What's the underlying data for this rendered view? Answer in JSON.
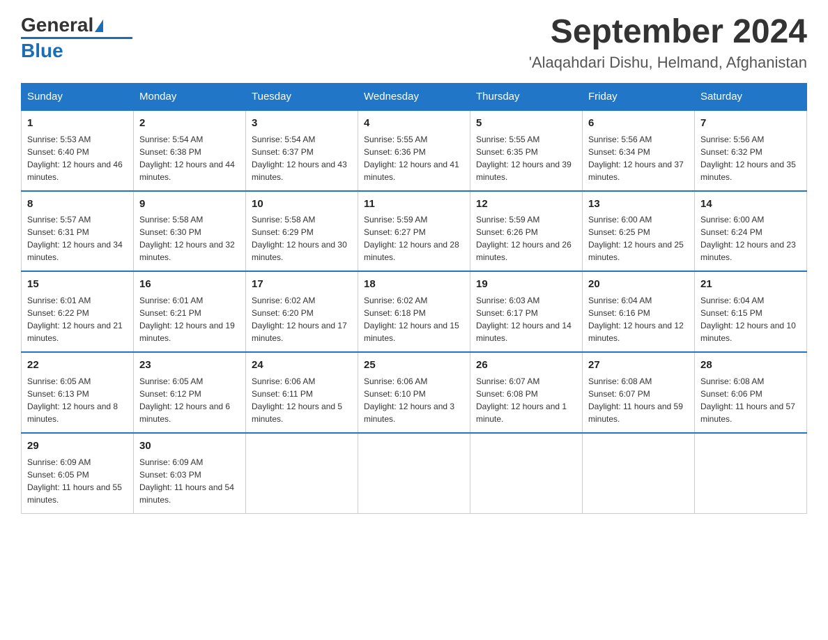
{
  "header": {
    "logo_general": "General",
    "logo_blue": "Blue",
    "month_title": "September 2024",
    "location": "'Alaqahdari Dishu, Helmand, Afghanistan"
  },
  "days_of_week": [
    "Sunday",
    "Monday",
    "Tuesday",
    "Wednesday",
    "Thursday",
    "Friday",
    "Saturday"
  ],
  "weeks": [
    [
      {
        "day": "1",
        "sunrise": "Sunrise: 5:53 AM",
        "sunset": "Sunset: 6:40 PM",
        "daylight": "Daylight: 12 hours and 46 minutes."
      },
      {
        "day": "2",
        "sunrise": "Sunrise: 5:54 AM",
        "sunset": "Sunset: 6:38 PM",
        "daylight": "Daylight: 12 hours and 44 minutes."
      },
      {
        "day": "3",
        "sunrise": "Sunrise: 5:54 AM",
        "sunset": "Sunset: 6:37 PM",
        "daylight": "Daylight: 12 hours and 43 minutes."
      },
      {
        "day": "4",
        "sunrise": "Sunrise: 5:55 AM",
        "sunset": "Sunset: 6:36 PM",
        "daylight": "Daylight: 12 hours and 41 minutes."
      },
      {
        "day": "5",
        "sunrise": "Sunrise: 5:55 AM",
        "sunset": "Sunset: 6:35 PM",
        "daylight": "Daylight: 12 hours and 39 minutes."
      },
      {
        "day": "6",
        "sunrise": "Sunrise: 5:56 AM",
        "sunset": "Sunset: 6:34 PM",
        "daylight": "Daylight: 12 hours and 37 minutes."
      },
      {
        "day": "7",
        "sunrise": "Sunrise: 5:56 AM",
        "sunset": "Sunset: 6:32 PM",
        "daylight": "Daylight: 12 hours and 35 minutes."
      }
    ],
    [
      {
        "day": "8",
        "sunrise": "Sunrise: 5:57 AM",
        "sunset": "Sunset: 6:31 PM",
        "daylight": "Daylight: 12 hours and 34 minutes."
      },
      {
        "day": "9",
        "sunrise": "Sunrise: 5:58 AM",
        "sunset": "Sunset: 6:30 PM",
        "daylight": "Daylight: 12 hours and 32 minutes."
      },
      {
        "day": "10",
        "sunrise": "Sunrise: 5:58 AM",
        "sunset": "Sunset: 6:29 PM",
        "daylight": "Daylight: 12 hours and 30 minutes."
      },
      {
        "day": "11",
        "sunrise": "Sunrise: 5:59 AM",
        "sunset": "Sunset: 6:27 PM",
        "daylight": "Daylight: 12 hours and 28 minutes."
      },
      {
        "day": "12",
        "sunrise": "Sunrise: 5:59 AM",
        "sunset": "Sunset: 6:26 PM",
        "daylight": "Daylight: 12 hours and 26 minutes."
      },
      {
        "day": "13",
        "sunrise": "Sunrise: 6:00 AM",
        "sunset": "Sunset: 6:25 PM",
        "daylight": "Daylight: 12 hours and 25 minutes."
      },
      {
        "day": "14",
        "sunrise": "Sunrise: 6:00 AM",
        "sunset": "Sunset: 6:24 PM",
        "daylight": "Daylight: 12 hours and 23 minutes."
      }
    ],
    [
      {
        "day": "15",
        "sunrise": "Sunrise: 6:01 AM",
        "sunset": "Sunset: 6:22 PM",
        "daylight": "Daylight: 12 hours and 21 minutes."
      },
      {
        "day": "16",
        "sunrise": "Sunrise: 6:01 AM",
        "sunset": "Sunset: 6:21 PM",
        "daylight": "Daylight: 12 hours and 19 minutes."
      },
      {
        "day": "17",
        "sunrise": "Sunrise: 6:02 AM",
        "sunset": "Sunset: 6:20 PM",
        "daylight": "Daylight: 12 hours and 17 minutes."
      },
      {
        "day": "18",
        "sunrise": "Sunrise: 6:02 AM",
        "sunset": "Sunset: 6:18 PM",
        "daylight": "Daylight: 12 hours and 15 minutes."
      },
      {
        "day": "19",
        "sunrise": "Sunrise: 6:03 AM",
        "sunset": "Sunset: 6:17 PM",
        "daylight": "Daylight: 12 hours and 14 minutes."
      },
      {
        "day": "20",
        "sunrise": "Sunrise: 6:04 AM",
        "sunset": "Sunset: 6:16 PM",
        "daylight": "Daylight: 12 hours and 12 minutes."
      },
      {
        "day": "21",
        "sunrise": "Sunrise: 6:04 AM",
        "sunset": "Sunset: 6:15 PM",
        "daylight": "Daylight: 12 hours and 10 minutes."
      }
    ],
    [
      {
        "day": "22",
        "sunrise": "Sunrise: 6:05 AM",
        "sunset": "Sunset: 6:13 PM",
        "daylight": "Daylight: 12 hours and 8 minutes."
      },
      {
        "day": "23",
        "sunrise": "Sunrise: 6:05 AM",
        "sunset": "Sunset: 6:12 PM",
        "daylight": "Daylight: 12 hours and 6 minutes."
      },
      {
        "day": "24",
        "sunrise": "Sunrise: 6:06 AM",
        "sunset": "Sunset: 6:11 PM",
        "daylight": "Daylight: 12 hours and 5 minutes."
      },
      {
        "day": "25",
        "sunrise": "Sunrise: 6:06 AM",
        "sunset": "Sunset: 6:10 PM",
        "daylight": "Daylight: 12 hours and 3 minutes."
      },
      {
        "day": "26",
        "sunrise": "Sunrise: 6:07 AM",
        "sunset": "Sunset: 6:08 PM",
        "daylight": "Daylight: 12 hours and 1 minute."
      },
      {
        "day": "27",
        "sunrise": "Sunrise: 6:08 AM",
        "sunset": "Sunset: 6:07 PM",
        "daylight": "Daylight: 11 hours and 59 minutes."
      },
      {
        "day": "28",
        "sunrise": "Sunrise: 6:08 AM",
        "sunset": "Sunset: 6:06 PM",
        "daylight": "Daylight: 11 hours and 57 minutes."
      }
    ],
    [
      {
        "day": "29",
        "sunrise": "Sunrise: 6:09 AM",
        "sunset": "Sunset: 6:05 PM",
        "daylight": "Daylight: 11 hours and 55 minutes."
      },
      {
        "day": "30",
        "sunrise": "Sunrise: 6:09 AM",
        "sunset": "Sunset: 6:03 PM",
        "daylight": "Daylight: 11 hours and 54 minutes."
      },
      null,
      null,
      null,
      null,
      null
    ]
  ]
}
